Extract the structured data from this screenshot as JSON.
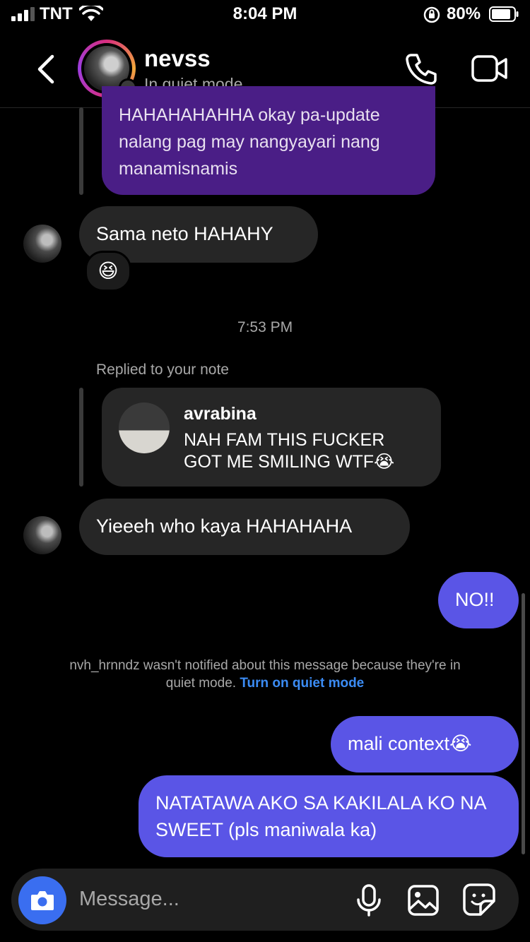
{
  "status": {
    "carrier": "TNT",
    "time": "8:04 PM",
    "battery_pct": "80%"
  },
  "header": {
    "name": "nevss",
    "subtitle": "In quiet mode"
  },
  "messages": {
    "m1_text": "HAHAHAHAHHA okay pa-update nalang pag may nangyayari nang manamisnamis",
    "m2_text": "Sama neto HAHAHY",
    "m2_reaction": "😆",
    "timestamp": "7:53 PM",
    "replied_label": "Replied to your note",
    "note_user": "avrabina",
    "note_text": "NAH FAM THIS FUCKER GOT ME SMILING WTF😭",
    "m3_text": "Yieeeh who kaya HAHAHAHA",
    "m4_text": "NO!!",
    "notice_text": "nvh_hrnndz wasn't notified about this message because they're in quiet mode.",
    "notice_link": "Turn on quiet mode",
    "m5_text": "mali context😭",
    "m6_text": "NATATAWA AKO SA KAKILALA KO NA SWEET (pls maniwala ka)"
  },
  "composer": {
    "placeholder": "Message..."
  },
  "icons": [
    "signal-icon",
    "wifi-icon",
    "orientation-lock-icon",
    "battery-icon",
    "back-chevron-icon",
    "phone-icon",
    "video-call-icon",
    "camera-icon",
    "microphone-icon",
    "gallery-icon",
    "sticker-icon"
  ],
  "colors": {
    "my_bubble": "#5a55e6",
    "their_bubble": "#262626",
    "reply_purple": "#4a1e86",
    "link_blue": "#3b8cf5",
    "camera_blue": "#3a6ef0"
  }
}
